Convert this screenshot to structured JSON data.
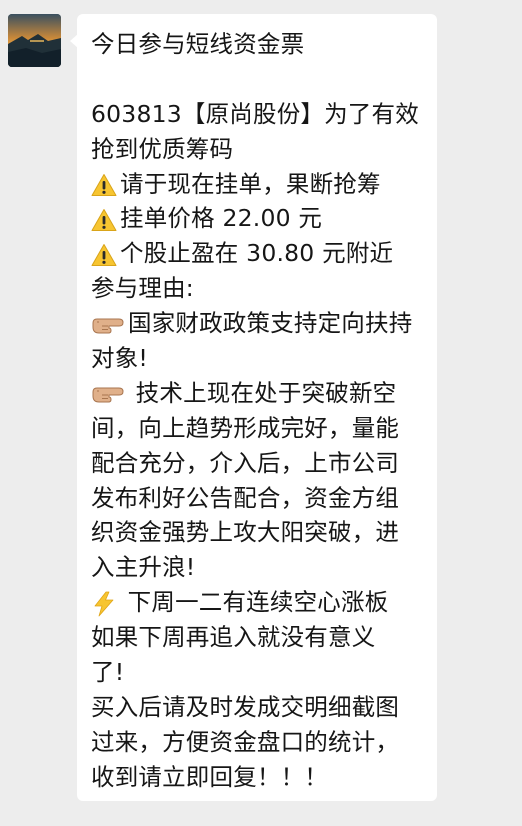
{
  "sender": {
    "avatar_icon": "landscape-avatar-icon"
  },
  "message": {
    "lines": [
      {
        "text": "今日参与短线资金票"
      },
      {
        "text": ""
      },
      {
        "text": "603813【原尚股份】为了有效"
      },
      {
        "text": "抢到优质筹码"
      },
      {
        "icon": "warning-icon",
        "text": "请于现在挂单，果断抢筹"
      },
      {
        "icon": "warning-icon",
        "text": "挂单价格  22.00 元"
      },
      {
        "icon": "warning-icon",
        "text": "个股止盈在 30.80 元附近"
      },
      {
        "text": "参与理由:"
      },
      {
        "icon": "pointing-hand-icon",
        "text": "国家财政政策支持定向扶持"
      },
      {
        "text": "对象!"
      },
      {
        "icon": "pointing-hand-icon",
        "text": " 技术上现在处于突破新空"
      },
      {
        "text": "间，向上趋势形成完好，量能"
      },
      {
        "text": "配合充分，介入后，上市公司"
      },
      {
        "text": "发布利好公告配合，资金方组"
      },
      {
        "text": "织资金强势上攻大阳突破，进"
      },
      {
        "text": "入主升浪!"
      },
      {
        "icon": "lightning-icon",
        "text": " 下周一二有连续空心涨板"
      },
      {
        "text": "如果下周再追入就没有意义"
      },
      {
        "text": "了!"
      },
      {
        "text": "买入后请及时发成交明细截图"
      },
      {
        "text": "过来，方便资金盘口的统计，"
      },
      {
        "text": "收到请立即回复！！！"
      }
    ]
  },
  "colors": {
    "background": "#ededed",
    "bubble": "#ffffff",
    "text": "#161616",
    "warning": "#f7c531",
    "hand": "#e0b08a",
    "lightning": "#f7c531"
  }
}
